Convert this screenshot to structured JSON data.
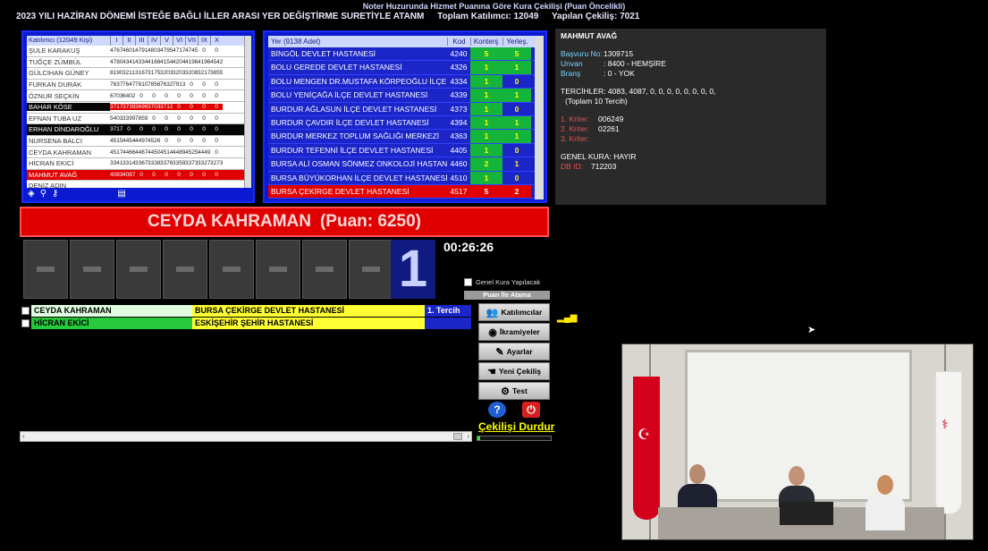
{
  "header": {
    "line1": "Noter Huzurunda Hizmet Puanına Göre Kura Çekilişi   (Puan Öncelikli)",
    "title": "2023 YILI HAZİRAN DÖNEMİ İSTEĞE BAĞLI İLLER ARASI YER DEĞİŞTİRME SURETİYLE ATANM",
    "total": "Toplam Katılımcı: 12049",
    "done": "Yapılan Çekiliş: 7021"
  },
  "participants": {
    "header": "Katılımcı  (12049 Kişi)",
    "cols": [
      "I",
      "II",
      "III",
      "IV",
      "V",
      "VI",
      "VII",
      "IX",
      "X"
    ],
    "rows": [
      {
        "name": "ŞULE KARAKUŞ",
        "vals": [
          "4767",
          "4601",
          "4791",
          "4803",
          "4795",
          "4717",
          "4745",
          "0",
          "0"
        ],
        "style": ""
      },
      {
        "name": "TUĞÇE ZÜMBÜL",
        "vals": [
          "4780",
          "4341",
          "4334",
          "4166",
          "4154",
          "4204",
          "4196",
          "4196",
          "4542"
        ],
        "style": ""
      },
      {
        "name": "GÜLCİHAN GÜNEY",
        "vals": [
          "8190",
          "3211",
          "3167",
          "3175",
          "3203",
          "3203",
          "3208",
          "3217",
          "3855"
        ],
        "style": ""
      },
      {
        "name": "FURKAN DURAK",
        "vals": [
          "7837",
          "7647",
          "7810",
          "7856",
          "7632",
          "7913",
          "0",
          "0",
          "0"
        ],
        "style": ""
      },
      {
        "name": "ÖZNUR SEÇKİN",
        "vals": [
          "6703",
          "6402",
          "0",
          "0",
          "0",
          "0",
          "0",
          "0",
          "0"
        ],
        "style": ""
      },
      {
        "name": "BAHAR KÖSE",
        "vals": [
          "3717",
          "3739",
          "3696",
          "3703",
          "3712",
          "0",
          "0",
          "0",
          "0"
        ],
        "style": "blackred"
      },
      {
        "name": "EFNAN TUBA UZ",
        "vals": [
          "5403",
          "3399",
          "7859",
          "0",
          "0",
          "0",
          "0",
          "0",
          "0"
        ],
        "style": ""
      },
      {
        "name": "ERHAN DİNDAROĞLU",
        "vals": [
          "3717",
          "0",
          "0",
          "0",
          "0",
          "0",
          "0",
          "0",
          "0"
        ],
        "style": "black"
      },
      {
        "name": "NURSENA BALCI",
        "vals": [
          "4515",
          "4454",
          "4497",
          "4526",
          "0",
          "0",
          "0",
          "0",
          "0"
        ],
        "style": ""
      },
      {
        "name": "CEYDA KAHRAMAN",
        "vals": [
          "4517",
          "4466",
          "4467",
          "4450",
          "4514",
          "4489",
          "4525",
          "4449",
          "0"
        ],
        "style": ""
      },
      {
        "name": "HİCRAN EKİCİ",
        "vals": [
          "3341",
          "3314",
          "3367",
          "3338",
          "3376",
          "3359",
          "3373",
          "3327",
          "3273"
        ],
        "style": ""
      },
      {
        "name": "MAHMUT AVAĞ",
        "vals": [
          "4083",
          "4087",
          "0",
          "0",
          "0",
          "0",
          "0",
          "0",
          "0"
        ],
        "style": "red"
      },
      {
        "name": "DENİZ ADIN",
        "vals": [
          "",
          "",
          "",
          "",
          "",
          "",
          "",
          "",
          ""
        ],
        "style": ""
      }
    ]
  },
  "hospitals": {
    "header": "Yer  (9138 Adet)",
    "col_kod": "Kod",
    "col_kontenjan": "Kontenj.",
    "col_yerlesen": "Yerleş.",
    "rows": [
      {
        "name": "BİNGÖL DEVLET HASTANESİ",
        "kod": "4240",
        "kon": "5",
        "yer": "5",
        "k": "g",
        "y": "g",
        "style": ""
      },
      {
        "name": "BOLU GEREDE DEVLET HASTANESİ",
        "kod": "4326",
        "kon": "1",
        "yer": "1",
        "k": "g",
        "y": "g",
        "style": ""
      },
      {
        "name": "BOLU MENGEN DR.MUSTAFA KÖRPEOĞLU İLÇE D",
        "kod": "4334",
        "kon": "1",
        "yer": "0",
        "k": "g",
        "y": "b",
        "style": ""
      },
      {
        "name": "BOLU YENİÇAĞA İLÇE DEVLET HASTANESİ",
        "kod": "4339",
        "kon": "1",
        "yer": "1",
        "k": "g",
        "y": "g",
        "style": ""
      },
      {
        "name": "BURDUR AĞLASUN İLÇE DEVLET HASTANESİ",
        "kod": "4373",
        "kon": "1",
        "yer": "0",
        "k": "g",
        "y": "b",
        "style": ""
      },
      {
        "name": "BURDUR ÇAVDIR İLÇE DEVLET HASTANESİ",
        "kod": "4394",
        "kon": "1",
        "yer": "1",
        "k": "g",
        "y": "g",
        "style": ""
      },
      {
        "name": "BURDUR MERKEZ TOPLUM SAĞLIĞI MERKEZİ",
        "kod": "4363",
        "kon": "1",
        "yer": "1",
        "k": "g",
        "y": "g",
        "style": ""
      },
      {
        "name": "BURDUR TEFENNİ İLÇE DEVLET HASTANESİ",
        "kod": "4405",
        "kon": "1",
        "yer": "0",
        "k": "g",
        "y": "b",
        "style": ""
      },
      {
        "name": "BURSA ALİ OSMAN SÖNMEZ ONKOLOJİ HASTANE",
        "kod": "4460",
        "kon": "2",
        "yer": "1",
        "k": "g",
        "y": "b",
        "style": ""
      },
      {
        "name": "BURSA BÜYÜKORHAN İLÇE DEVLET HASTANESİ",
        "kod": "4510",
        "kon": "1",
        "yer": "0",
        "k": "g",
        "y": "b",
        "style": ""
      },
      {
        "name": "BURSA ÇEKİRGE DEVLET HASTANESİ",
        "kod": "4517",
        "kon": "5",
        "yer": "2",
        "k": "r",
        "y": "r",
        "style": "red"
      }
    ]
  },
  "info": {
    "name": "MAHMUT AVAĞ",
    "basvuru_label": "Başvuru No:",
    "basvuru": "1309715",
    "unvan_label": "Unvan",
    "unvan": ": 8400 - HEMŞİRE",
    "brans_label": "Branş",
    "brans": ": 0 - YOK",
    "tercihler": "TERCİHLER:  4083, 4087, 0, 0, 0, 0, 0, 0, 0, 0,",
    "toplam": "(Toplam 10 Tercih)",
    "k1_label": "1. Kriter:",
    "k1": "006249",
    "k2_label": "2. Kriter:",
    "k2": "02261",
    "k3_label": "3. Kriter:",
    "genel": "GENEL KURA:  HAYIR",
    "dbid_label": "DB ID:",
    "dbid": "712203"
  },
  "winner": {
    "name": "CEYDA KAHRAMAN",
    "score": "(Puan: 6250)"
  },
  "draw": {
    "digit": "1",
    "timer": "00:26:26"
  },
  "options": {
    "genel_kura": "Genel Kura Yapılacak",
    "mode": "Puan İle Atama"
  },
  "results": [
    {
      "name": "CEYDA KAHRAMAN",
      "hospital": "BURSA ÇEKİRGE DEVLET HASTANESİ",
      "tercih": "1. Tercih"
    },
    {
      "name": "HİCRAN EKİCİ",
      "hospital": "ESKİŞEHİR ŞEHİR HASTANESİ",
      "tercih": ""
    }
  ],
  "buttons": {
    "katilimcilar": "Katılımcılar",
    "ikramiyeler": "İkramiyeler",
    "ayarlar": "Ayarlar",
    "yeni": "Yeni Çekiliş",
    "test": "Test",
    "help": "?",
    "power": "⏻",
    "durdur": "Çekilişi Durdur"
  }
}
